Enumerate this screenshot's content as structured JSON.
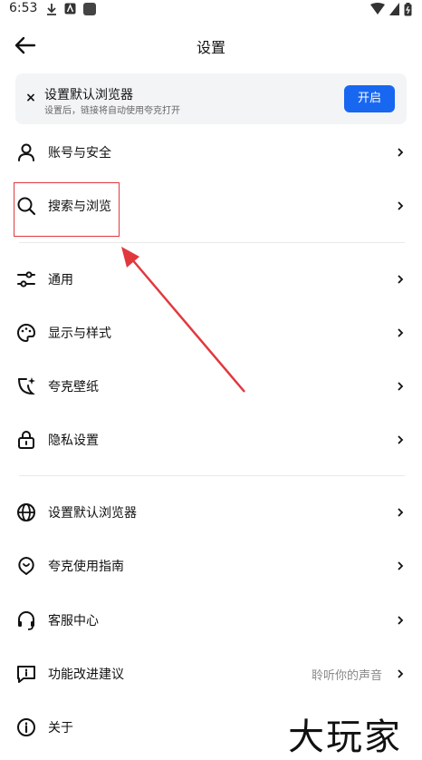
{
  "status_bar": {
    "time": "6:53"
  },
  "header": {
    "title": "设置"
  },
  "banner": {
    "title": "设置默认浏览器",
    "subtitle": "设置后，链接将自动使用夸克打开",
    "button_label": "开启",
    "close_label": "×"
  },
  "menu": {
    "items": [
      {
        "label": "账号与安全",
        "icon": "user-icon"
      },
      {
        "label": "搜索与浏览",
        "icon": "search-icon"
      },
      {
        "label": "通用",
        "icon": "sliders-icon"
      },
      {
        "label": "显示与样式",
        "icon": "palette-icon"
      },
      {
        "label": "夸克壁纸",
        "icon": "wallpaper-icon"
      },
      {
        "label": "隐私设置",
        "icon": "lock-icon"
      },
      {
        "label": "设置默认浏览器",
        "icon": "globe-icon"
      },
      {
        "label": "夸克使用指南",
        "icon": "guide-icon"
      },
      {
        "label": "客服中心",
        "icon": "headset-icon"
      },
      {
        "label": "功能改进建议",
        "icon": "feedback-icon",
        "value": "聆听你的声音"
      },
      {
        "label": "关于",
        "icon": "info-icon"
      }
    ]
  },
  "watermark": "大玩家",
  "colors": {
    "accent": "#1767f1",
    "annotation": "#e1383e"
  }
}
